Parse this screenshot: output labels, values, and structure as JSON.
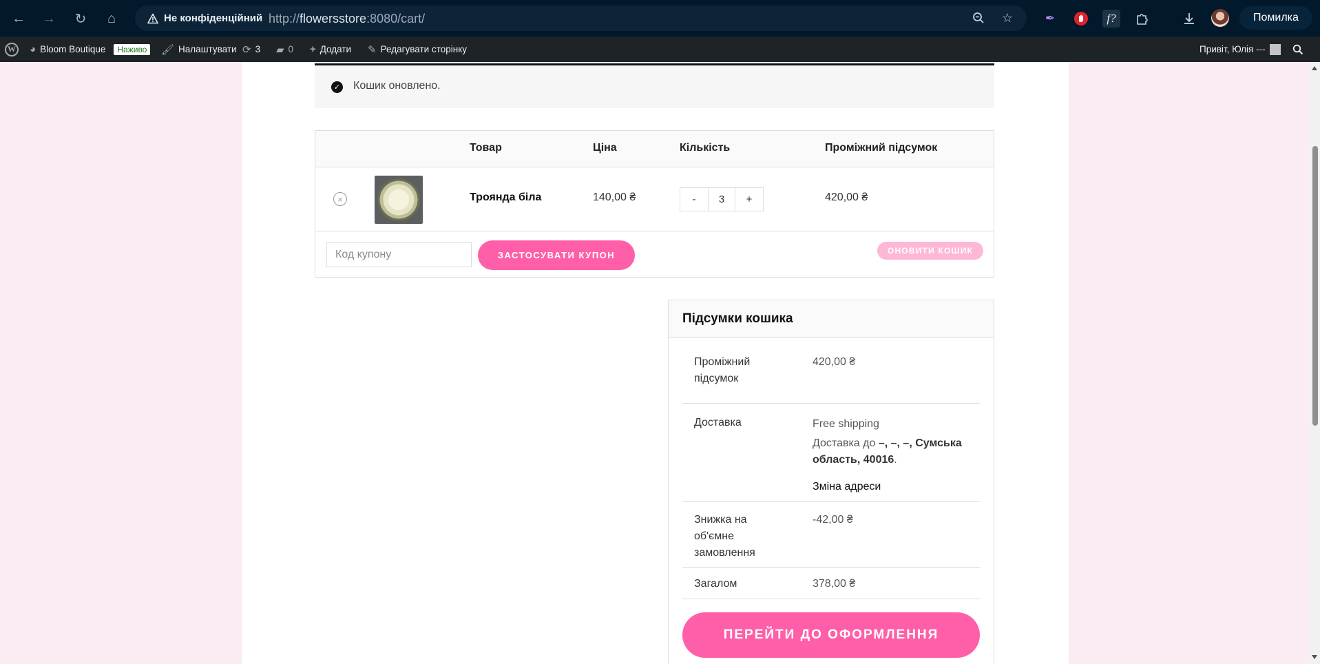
{
  "browser": {
    "security_label": "Не конфіденційний",
    "url_scheme": "http://",
    "url_host": "flowersstore",
    "url_rest": ":8080/cart/",
    "error_label": "Помилка"
  },
  "adminbar": {
    "site_name": "Bloom Boutique",
    "live_badge": "Наживо",
    "customize": "Налаштувати",
    "updates_count": "3",
    "comments_count": "0",
    "add_new": "Додати",
    "edit_page": "Редагувати сторінку",
    "greeting": "Привіт, Юлія ---"
  },
  "notice": {
    "text": "Кошик оновлено."
  },
  "cart": {
    "headers": {
      "product": "Товар",
      "price": "Ціна",
      "quantity": "Кількість",
      "subtotal": "Проміжний підсумок"
    },
    "items": [
      {
        "name": "Троянда біла",
        "price": "140,00 ₴",
        "quantity": "3",
        "subtotal": "420,00 ₴",
        "minus": "-",
        "plus": "+",
        "remove": "×"
      }
    ],
    "coupon_placeholder": "Код купону",
    "apply_coupon": "ЗАСТОСУВАТИ КУПОН",
    "update_cart": "ОНОВИТИ КОШИК"
  },
  "totals": {
    "title": "Підсумки кошика",
    "subtotal_label": "Проміжний підсумок",
    "subtotal_value": "420,00 ₴",
    "shipping_label": "Доставка",
    "shipping_method": "Free shipping",
    "shipping_to_prefix": "Доставка до ",
    "shipping_to_address": "–, –, –, Сумська область, 40016",
    "shipping_to_suffix": ".",
    "change_address": "Зміна адреси",
    "discount_label": "Знижка на об'ємне замовлення",
    "discount_value": "-42,00 ₴",
    "total_label": "Загалом",
    "total_value": "378,00 ₴",
    "checkout": "ПЕРЕЙТИ ДО ОФОРМЛЕННЯ"
  },
  "colors": {
    "accent": "#ff5fa8",
    "accent_light": "#ffb7d6",
    "page_bg": "#fbecf3",
    "chrome": "#02182b",
    "adminbar": "#1d2327"
  }
}
